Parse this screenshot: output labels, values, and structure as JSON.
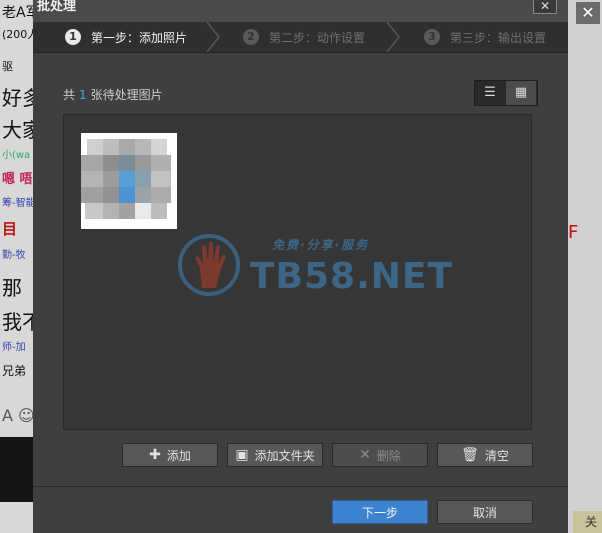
{
  "background_app": {
    "lines": [
      "老A军",
      "(200人",
      "驱",
      "好多",
      "大家",
      "小(wa",
      "嗯 唔",
      "筹-智能",
      "目",
      "勤-牧",
      "那",
      "我不",
      "师-加",
      "兄弟",
      "A ☺"
    ],
    "right_close_glyph": "✕",
    "bottom_button_label": "关"
  },
  "dialog": {
    "title": "批处理",
    "close_glyph": "✕",
    "steps": [
      {
        "number": "1",
        "label": "第一步：添加照片",
        "active": true
      },
      {
        "number": "2",
        "label": "第二步：动作设置",
        "active": false
      },
      {
        "number": "3",
        "label": "第三步：输出设置",
        "active": false
      }
    ],
    "count": {
      "prefix": "共",
      "value": "1",
      "suffix": "张待处理图片"
    },
    "view_toggle": {
      "list_glyph": "☰",
      "grid_glyph": "▦"
    },
    "actions": [
      {
        "label": "添加",
        "icon": "plus-icon",
        "glyph": "✚",
        "enabled": true
      },
      {
        "label": "添加文件夹",
        "icon": "folder-add-icon",
        "glyph": "▣",
        "enabled": true
      },
      {
        "label": "删除",
        "icon": "cross-icon",
        "glyph": "✕",
        "enabled": false
      },
      {
        "label": "清空",
        "icon": "trash-icon",
        "glyph": "🗑",
        "enabled": true
      }
    ],
    "footer": {
      "next_label": "下一步",
      "cancel_label": "取消"
    },
    "watermark": {
      "text": "TB58.NET",
      "slogan": "免费·分享·服务"
    },
    "colors": {
      "accent": "#3c84cf",
      "count_value": "#3ea8e6",
      "watermark": "#3e6e95"
    }
  }
}
